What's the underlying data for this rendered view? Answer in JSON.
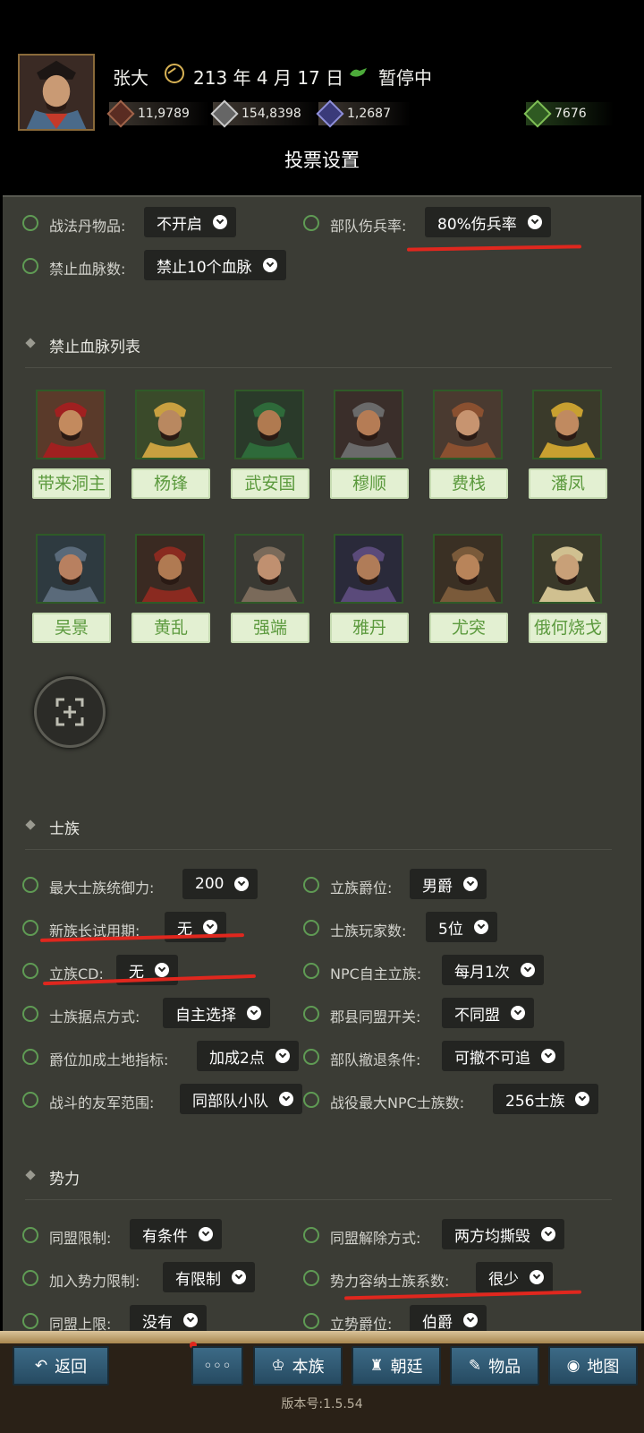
{
  "header": {
    "player_name": "张大",
    "date": "213 年 4 月 17 日",
    "status": "暂停中",
    "resources": [
      {
        "icon": "copper-coin-icon",
        "value": "11,9789"
      },
      {
        "icon": "grain-icon",
        "value": "154,8398"
      },
      {
        "icon": "troops-icon",
        "value": "1,2687"
      }
    ],
    "gold": {
      "icon": "money-bag-icon",
      "value": "7676"
    }
  },
  "title": "投票设置",
  "settings_top": [
    {
      "label": "战法丹物品:",
      "value": "不开启"
    },
    {
      "label": "部队伤兵率:",
      "value": "80%伤兵率"
    },
    {
      "label": "禁止血脉数:",
      "value": "禁止10个血脉"
    }
  ],
  "bloodline_section": {
    "title": "禁止血脉列表",
    "row1": [
      "带来洞主",
      "杨锋",
      "武安国",
      "穆顺",
      "费栈",
      "潘凤"
    ],
    "row2": [
      "吴景",
      "黄乱",
      "强端",
      "雅丹",
      "尤突",
      "俄何烧戈"
    ]
  },
  "clan_section": {
    "title": "士族",
    "items": [
      {
        "label": "最大士族统御力:",
        "value": "200"
      },
      {
        "label": "立族爵位:",
        "value": "男爵"
      },
      {
        "label": "新族长试用期:",
        "value": "无"
      },
      {
        "label": "士族玩家数:",
        "value": "5位"
      },
      {
        "label": "立族CD:",
        "value": "无"
      },
      {
        "label": "NPC自主立族:",
        "value": "每月1次"
      },
      {
        "label": "士族据点方式:",
        "value": "自主选择"
      },
      {
        "label": "郡县同盟开关:",
        "value": "不同盟"
      },
      {
        "label": "爵位加成土地指标:",
        "value": "加成2点"
      },
      {
        "label": "部队撤退条件:",
        "value": "可撤不可追"
      },
      {
        "label": "战斗的友军范围:",
        "value": "同部队小队"
      },
      {
        "label": "战役最大NPC士族数:",
        "value": "256士族"
      }
    ]
  },
  "power_section": {
    "title": "势力",
    "items": [
      {
        "label": "同盟限制:",
        "value": "有条件"
      },
      {
        "label": "同盟解除方式:",
        "value": "两方均撕毁"
      },
      {
        "label": "加入势力限制:",
        "value": "有限制"
      },
      {
        "label": "势力容纳士族系数:",
        "value": "很少"
      },
      {
        "label": "同盟上限:",
        "value": "没有"
      },
      {
        "label": "立势爵位:",
        "value": "伯爵"
      }
    ]
  },
  "bottom_nav": {
    "back": "返回",
    "more": "◦◦◦",
    "clan": "本族",
    "court": "朝廷",
    "items": "物品",
    "map": "地图"
  },
  "version": "版本号:1.5.54"
}
